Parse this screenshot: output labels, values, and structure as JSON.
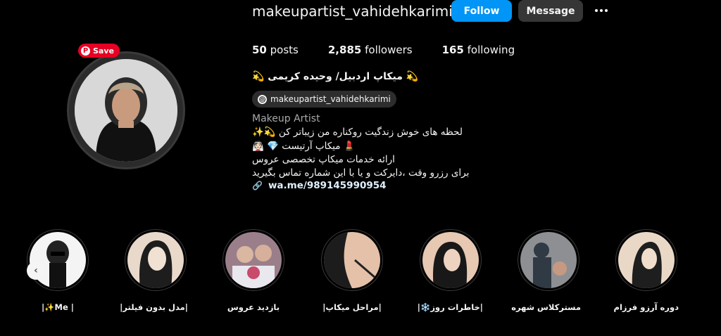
{
  "header": {
    "username": "makeupartist_vahidehkarimi",
    "follow_label": "Follow",
    "message_label": "Message",
    "more_icon": "more-horizontal-icon"
  },
  "pinterest": {
    "save_label": "Save",
    "color": "#e60023"
  },
  "stats": [
    {
      "count": "50",
      "label": "posts"
    },
    {
      "count": "2,885",
      "label": "followers"
    },
    {
      "count": "165",
      "label": "following"
    }
  ],
  "bio": {
    "display_name": "💫 میکاپ اردبیل/ وحیده کریمی 💫",
    "threads_handle": "makeupartist_vahidehkarimi",
    "category": "Makeup Artist",
    "lines": [
      "لحظه های خوش زندگیت روکناره من زیباتر کن 💫✨",
      "💄 میکاپ آرتیست 💎 👰🏻",
      "ارائه خدمات میکاپ تخصصی عروس",
      "برای رزرو وقت ،دایرکت و یا با این شماره تماس بگیرید"
    ],
    "link": "wa.me/989145990954"
  },
  "highlights": [
    {
      "label": "| Me✨|"
    },
    {
      "label": "|مدل بدون فیلتر|"
    },
    {
      "label": "بازدید عروس"
    },
    {
      "label": "|مراحل میکاپ|"
    },
    {
      "label": "|خاطرات روز❄️|"
    },
    {
      "label": "مسترکلاس شهره"
    },
    {
      "label": "دوره آرزو فرزام"
    }
  ],
  "colors": {
    "background": "#000000",
    "follow": "#0095f6",
    "secondary_button": "#363636",
    "link": "#e0f1ff"
  }
}
